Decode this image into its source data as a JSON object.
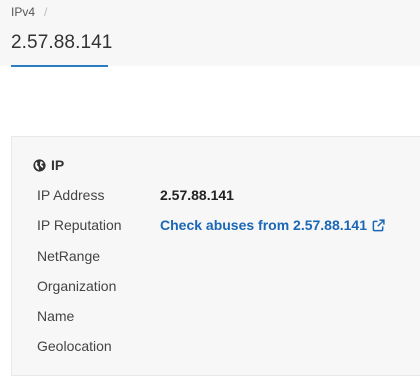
{
  "breadcrumb": {
    "item": "IPv4",
    "separator": "/"
  },
  "page_title": "2.57.88.141",
  "section": {
    "title": "IP",
    "icon": "globe-icon"
  },
  "fields": {
    "ip_address": {
      "label": "IP Address",
      "value": "2.57.88.141"
    },
    "ip_reputation": {
      "label": "IP Reputation",
      "link_text": "Check abuses from 2.57.88.141",
      "icon": "external-link-icon"
    },
    "netrange": {
      "label": "NetRange"
    },
    "organization": {
      "label": "Organization"
    },
    "name": {
      "label": "Name"
    },
    "geolocation": {
      "label": "Geolocation"
    }
  },
  "colors": {
    "accent": "#2a7fc4",
    "link": "#1a67b5",
    "header_bg": "#f7f7f7"
  }
}
